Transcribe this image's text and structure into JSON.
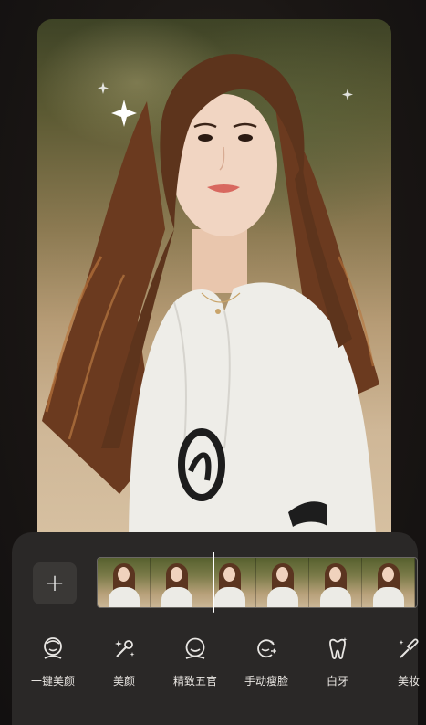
{
  "add_button": {
    "label": "+"
  },
  "filmstrip": {
    "frames": 6
  },
  "tools": [
    {
      "label": "一键美颜",
      "icon": "one-key-beauty-icon"
    },
    {
      "label": "美颜",
      "icon": "magic-wand-icon"
    },
    {
      "label": "精致五官",
      "icon": "face-features-icon"
    },
    {
      "label": "手动瘦脸",
      "icon": "slim-face-icon"
    },
    {
      "label": "白牙",
      "icon": "tooth-icon"
    },
    {
      "label": "美妆",
      "icon": "makeup-brush-icon"
    }
  ],
  "colors": {
    "panel": "#2a2827",
    "accent_white": "#ffffff"
  }
}
